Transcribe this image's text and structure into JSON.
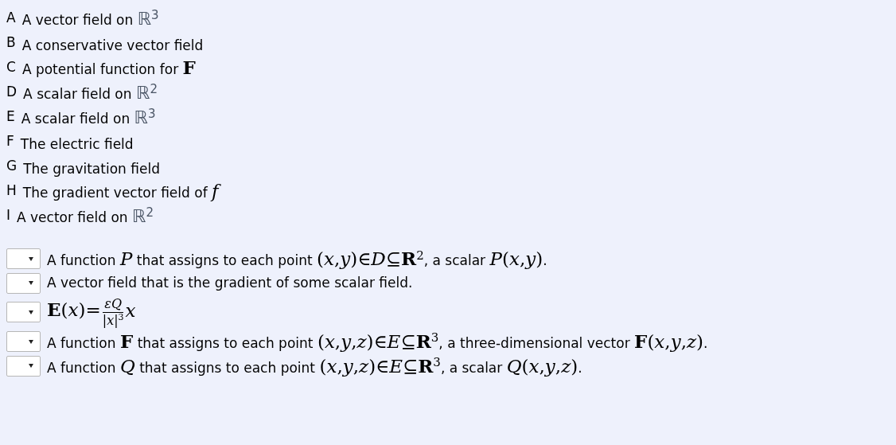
{
  "options": [
    {
      "letter": "A",
      "parts": [
        {
          "kind": "text",
          "s": "A vector field on "
        },
        {
          "kind": "set",
          "s": "ℝ$^{3}$"
        }
      ]
    },
    {
      "letter": "B",
      "parts": [
        {
          "kind": "text",
          "s": "A conservative vector field"
        }
      ]
    },
    {
      "letter": "C",
      "parts": [
        {
          "kind": "text",
          "s": "A potential function for "
        },
        {
          "kind": "math",
          "s": "**F**"
        }
      ]
    },
    {
      "letter": "D",
      "parts": [
        {
          "kind": "text",
          "s": "A scalar field on "
        },
        {
          "kind": "set",
          "s": "ℝ$^{2}$"
        }
      ]
    },
    {
      "letter": "E",
      "parts": [
        {
          "kind": "text",
          "s": "A scalar field on "
        },
        {
          "kind": "set",
          "s": "ℝ$^{3}$"
        }
      ]
    },
    {
      "letter": "F",
      "parts": [
        {
          "kind": "text",
          "s": "The electric field"
        }
      ]
    },
    {
      "letter": "G",
      "parts": [
        {
          "kind": "text",
          "s": "The gravitation field"
        }
      ]
    },
    {
      "letter": "H",
      "parts": [
        {
          "kind": "text",
          "s": "The gradient vector field of "
        },
        {
          "kind": "math",
          "s": "*f*"
        }
      ]
    },
    {
      "letter": "I",
      "parts": [
        {
          "kind": "text",
          "s": "A vector field on "
        },
        {
          "kind": "set",
          "s": "ℝ$^{2}$"
        }
      ]
    }
  ],
  "statements": [
    {
      "parts": [
        {
          "kind": "text",
          "s": "A function "
        },
        {
          "kind": "math",
          "s": "*P*"
        },
        {
          "kind": "text",
          "s": " that assigns to each point "
        },
        {
          "kind": "math",
          "s": "(*x*,*y*)∈*D*⊆**R**$^{2}$"
        },
        {
          "kind": "text",
          "s": ", a scalar "
        },
        {
          "kind": "math",
          "s": "*P*(*x*,*y*)"
        },
        {
          "kind": "text",
          "s": "."
        }
      ]
    },
    {
      "parts": [
        {
          "kind": "text",
          "s": "A vector field that is the gradient of some scalar field."
        }
      ]
    },
    {
      "parts": [
        {
          "kind": "math",
          "s": "**E**(*x*)="
        },
        {
          "kind": "frac",
          "num": "*εQ*",
          "den": "|*x*|$^{3}$"
        },
        {
          "kind": "math",
          "s": "*x*"
        }
      ]
    },
    {
      "parts": [
        {
          "kind": "text",
          "s": "A function "
        },
        {
          "kind": "math",
          "s": "**F**"
        },
        {
          "kind": "text",
          "s": " that assigns to each point "
        },
        {
          "kind": "math",
          "s": "(*x*,*y*,*z*)∈*E*⊆**R**$^{3}$"
        },
        {
          "kind": "text",
          "s": ", a three-dimensional vector "
        },
        {
          "kind": "math",
          "s": "**F**(*x*,*y*,*z*)"
        },
        {
          "kind": "text",
          "s": "."
        }
      ]
    },
    {
      "parts": [
        {
          "kind": "text",
          "s": "A function "
        },
        {
          "kind": "math",
          "s": "*Q*"
        },
        {
          "kind": "text",
          "s": " that assigns to each point "
        },
        {
          "kind": "math",
          "s": "(*x*,*y*,*z*)∈*E*⊆**R**$^{3}$"
        },
        {
          "kind": "text",
          "s": ", a scalar "
        },
        {
          "kind": "math",
          "s": "*Q*(*x*,*y*,*z*)"
        },
        {
          "kind": "text",
          "s": "."
        }
      ]
    }
  ]
}
